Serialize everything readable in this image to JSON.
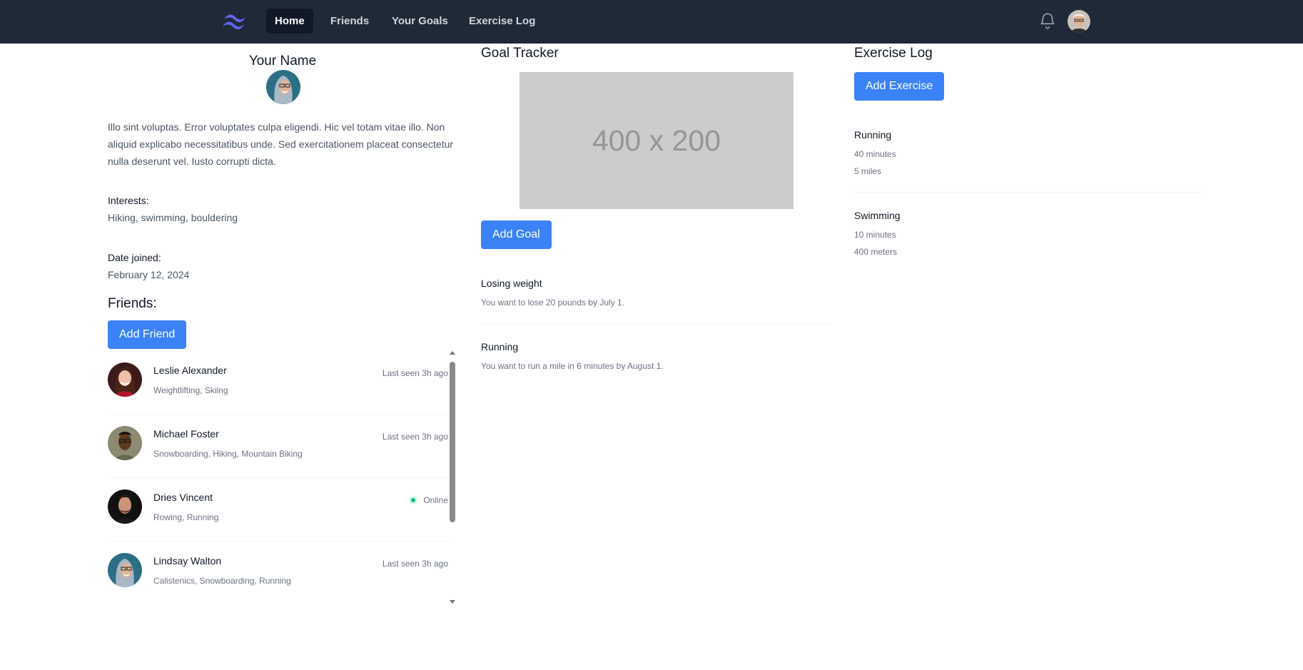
{
  "nav": {
    "links": [
      {
        "label": "Home",
        "active": true
      },
      {
        "label": "Friends",
        "active": false
      },
      {
        "label": "Your Goals",
        "active": false
      },
      {
        "label": "Exercise Log",
        "active": false
      }
    ],
    "icons": {
      "logo": "tailwind-logo-icon",
      "notifications": "bell-icon"
    }
  },
  "profile": {
    "name": "Your Name",
    "bio": "Illo sint voluptas. Error voluptates culpa eligendi. Hic vel totam vitae illo. Non aliquid explicabo necessitatibus unde. Sed exercitationem placeat consectetur nulla deserunt vel. Iusto corrupti dicta.",
    "interests_label": "Interests:",
    "interests_value": "Hiking, swimming, bouldering",
    "date_joined_label": "Date joined:",
    "date_joined_value": "February 12, 2024"
  },
  "friends": {
    "heading": "Friends:",
    "add_button": "Add Friend",
    "items": [
      {
        "name": "Leslie Alexander",
        "interests": "Weightlifting, Skiing",
        "status": "Last seen 3h ago",
        "online": false
      },
      {
        "name": "Michael Foster",
        "interests": "Snowboarding, Hiking, Mountain Biking",
        "status": "Last seen 3h ago",
        "online": false
      },
      {
        "name": "Dries Vincent",
        "interests": "Rowing, Running",
        "status": "Online",
        "online": true
      },
      {
        "name": "Lindsay Walton",
        "interests": "Calistenics, Snowboarding, Running",
        "status": "Last seen 3h ago",
        "online": false
      }
    ]
  },
  "goals": {
    "title": "Goal Tracker",
    "placeholder_text": "400 x 200",
    "add_button": "Add Goal",
    "items": [
      {
        "title": "Losing weight",
        "desc": "You want to lose 20 pounds by July 1."
      },
      {
        "title": "Running",
        "desc": "You want to run a mile in 6 minutes by August 1."
      }
    ]
  },
  "exercise": {
    "title": "Exercise Log",
    "add_button": "Add Exercise",
    "items": [
      {
        "name": "Running",
        "duration": "40 minutes",
        "distance": "5 miles"
      },
      {
        "name": "Swimming",
        "duration": "10 minutes",
        "distance": "400 meters"
      }
    ]
  },
  "colors": {
    "nav_bg": "#1f2937",
    "primary": "#3b82f6",
    "logo": "#6366f1",
    "online": "#10b981"
  }
}
